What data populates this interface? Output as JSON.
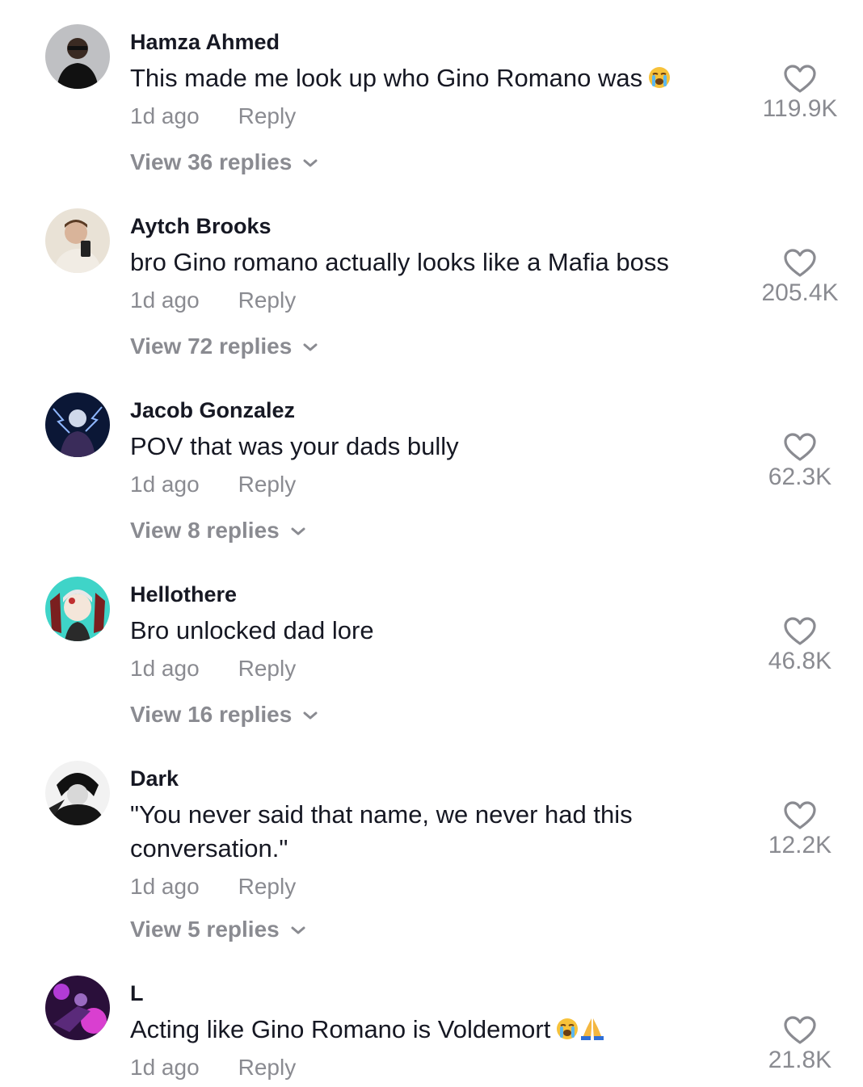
{
  "comments": [
    {
      "username": "Hamza Ahmed",
      "text": "This made me look up who Gino Romano was",
      "emojis": [
        "loudly-crying-face"
      ],
      "time": "1d ago",
      "reply": "Reply",
      "view_replies": "View 36 replies",
      "likes": "119.9K"
    },
    {
      "username": "Aytch Brooks",
      "text": "bro Gino romano actually looks like a Mafia boss",
      "emojis": [],
      "time": "1d ago",
      "reply": "Reply",
      "view_replies": "View 72 replies",
      "likes": "205.4K"
    },
    {
      "username": "Jacob Gonzalez",
      "text": "POV that was your dads bully",
      "emojis": [],
      "time": "1d ago",
      "reply": "Reply",
      "view_replies": "View 8 replies",
      "likes": "62.3K"
    },
    {
      "username": "Hellothere",
      "text": "Bro unlocked dad lore",
      "emojis": [],
      "time": "1d ago",
      "reply": "Reply",
      "view_replies": "View 16 replies",
      "likes": "46.8K"
    },
    {
      "username": "Dark",
      "text": "\"You never said that name, we never had this conversation.\"",
      "emojis": [],
      "time": "1d ago",
      "reply": "Reply",
      "view_replies": "View 5 replies",
      "likes": "12.2K"
    },
    {
      "username": "L",
      "text": "Acting like Gino Romano is Voldemort",
      "emojis": [
        "loudly-crying-face",
        "folded-hands"
      ],
      "time": "1d ago",
      "reply": "Reply",
      "view_replies": "",
      "likes": "21.8K"
    }
  ],
  "colors": {
    "username": "#161823",
    "secondary": "#8a8b91",
    "heart_outline": "#8a8b91"
  }
}
